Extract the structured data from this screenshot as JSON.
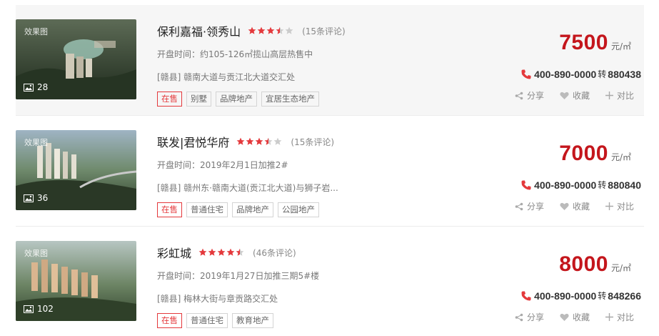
{
  "listings": [
    {
      "name": "保利嘉福·领秀山",
      "rating": 3.5,
      "reviews": "(15条评论)",
      "open_time": "开盘时间：约105-126㎡揽山高层热售中",
      "address": "[赣县] 赣南大道与贡江北大道交汇处",
      "badges": [
        "在售",
        "别墅",
        "品牌地产",
        "宜居生态地产"
      ],
      "price": "7500",
      "unit": "元/㎡",
      "phone": "400-890-0000",
      "transfer": "转",
      "ext": "880438",
      "image_tag": "效果图",
      "photo_count": "28"
    },
    {
      "name": "联发|君悦华府",
      "rating": 3.5,
      "reviews": "(15条评论)",
      "open_time": "开盘时间：2019年2月1日加推2#",
      "address": "[赣县] 赣州东·赣南大道(贡江北大道)与狮子岩...",
      "badges": [
        "在售",
        "普通住宅",
        "品牌地产",
        "公园地产"
      ],
      "price": "7000",
      "unit": "元/㎡",
      "phone": "400-890-0000",
      "transfer": "转",
      "ext": "880840",
      "image_tag": "效果图",
      "photo_count": "36"
    },
    {
      "name": "彩虹城",
      "rating": 4.5,
      "reviews": "(46条评论)",
      "open_time": "开盘时间：2019年1月27日加推三期5#楼",
      "address": "[赣县] 梅林大街与章贡路交汇处",
      "badges": [
        "在售",
        "普通住宅",
        "教育地产"
      ],
      "price": "8000",
      "unit": "元/㎡",
      "phone": "400-890-0000",
      "transfer": "转",
      "ext": "848266",
      "image_tag": "效果图",
      "photo_count": "102"
    }
  ],
  "actions": {
    "share": "分享",
    "favorite": "收藏",
    "compare": "对比"
  },
  "colors": {
    "price": "#c4161c",
    "star": "#e4393c",
    "sale_badge": "#e4393c",
    "phone_icon": "#e4393c"
  }
}
